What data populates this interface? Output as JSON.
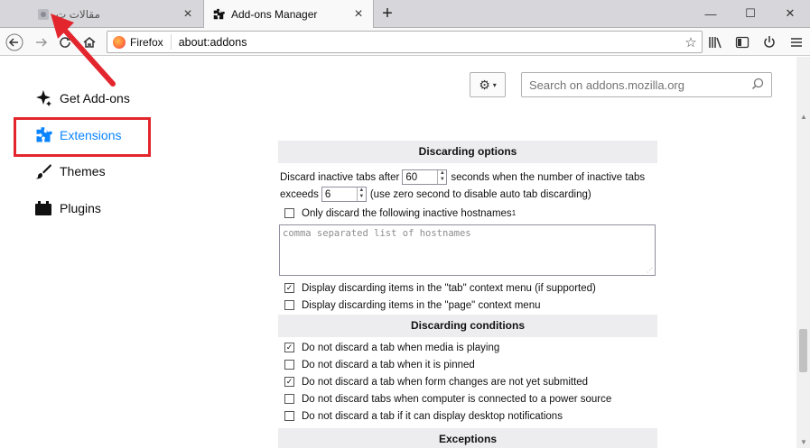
{
  "tabs": [
    {
      "title": "مقالات ت",
      "active": false
    },
    {
      "title": "Add-ons Manager",
      "active": true
    }
  ],
  "navbar": {
    "identity_label": "Firefox",
    "url": "about:addons"
  },
  "sidebar": {
    "items": [
      {
        "label": "Get Add-ons",
        "icon": "sparkle-puzzle-icon"
      },
      {
        "label": "Extensions",
        "icon": "puzzle-icon",
        "selected": true
      },
      {
        "label": "Themes",
        "icon": "brush-icon"
      },
      {
        "label": "Plugins",
        "icon": "plugin-block-icon"
      }
    ]
  },
  "search": {
    "placeholder": "Search on addons.mozilla.org"
  },
  "options": {
    "discarding_options_heading": "Discarding options",
    "discard_text_1": "Discard inactive tabs after",
    "discard_seconds_value": "60",
    "discard_text_2": "seconds when the number of inactive tabs",
    "exceeds_label": "exceeds",
    "exceeds_value": "6",
    "exceeds_note": "(use zero second to disable auto tab discarding)",
    "only_discard_label": "Only discard the following inactive hostnames",
    "only_discard_sup": "1",
    "hostnames_placeholder": "comma separated list of hostnames",
    "display_tab_menu": "Display discarding items in the \"tab\" context menu (if supported)",
    "display_page_menu": "Display discarding items in the \"page\" context menu",
    "discarding_conditions_heading": "Discarding conditions",
    "cond_media": "Do not discard a tab when media is playing",
    "cond_pinned": "Do not discard a tab when it is pinned",
    "cond_forms": "Do not discard a tab when form changes are not yet submitted",
    "cond_power": "Do not discard tabs when computer is connected to a power source",
    "cond_notifications": "Do not discard a tab if it can display desktop notifications",
    "exceptions_heading": "Exceptions"
  },
  "checked": {
    "only_discard": false,
    "display_tab_menu": true,
    "display_page_menu": false,
    "cond_media": true,
    "cond_pinned": false,
    "cond_forms": true,
    "cond_power": false,
    "cond_notifications": false
  },
  "colors": {
    "accent": "#0a84ff",
    "highlight": "#e3262d"
  }
}
